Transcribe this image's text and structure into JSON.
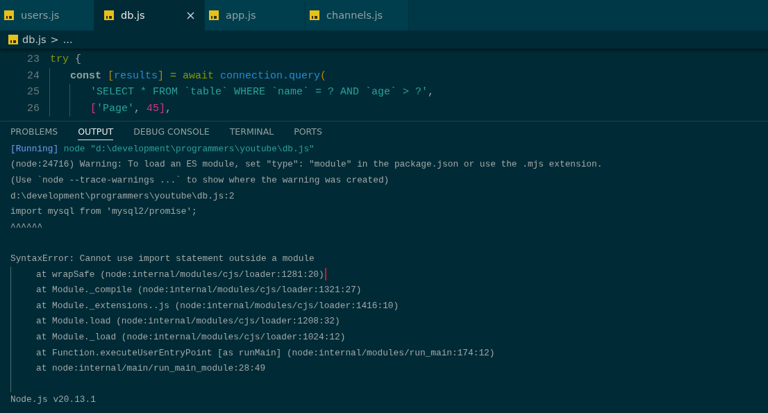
{
  "tabs": [
    {
      "label": "users.js",
      "selected": false
    },
    {
      "label": "db.js",
      "selected": true
    },
    {
      "label": "app.js",
      "selected": false
    },
    {
      "label": "channels.js",
      "selected": false
    }
  ],
  "breadcrumb": {
    "file": "db.js",
    "separator": ">",
    "rest": "..."
  },
  "editor": {
    "lines": [
      {
        "number": "23",
        "tokens": [
          {
            "kind": "keyword",
            "text": "try"
          },
          {
            "kind": "plain",
            "text": " {"
          }
        ],
        "children": [
          {
            "number": "24",
            "tokens": [
              {
                "kind": "storage",
                "text": "const "
              },
              {
                "kind": "bracket",
                "text": "["
              },
              {
                "kind": "variable",
                "text": "results"
              },
              {
                "kind": "bracket",
                "text": "] "
              },
              {
                "kind": "keyword",
                "text": "= await "
              },
              {
                "kind": "variable",
                "text": "connection.query"
              },
              {
                "kind": "bracket",
                "text": "("
              }
            ],
            "children": [
              {
                "number": "25",
                "tokens": [
                  {
                    "kind": "string",
                    "text": "'SELECT * FROM `table` WHERE `name` = ? AND `age` > ?'"
                  },
                  {
                    "kind": "plain",
                    "text": ","
                  }
                ]
              },
              {
                "number": "26",
                "tokens": [
                  {
                    "kind": "array",
                    "text": "["
                  },
                  {
                    "kind": "string",
                    "text": "'Page'"
                  },
                  {
                    "kind": "plain",
                    "text": ", "
                  },
                  {
                    "kind": "number",
                    "text": "45"
                  },
                  {
                    "kind": "array",
                    "text": "]"
                  },
                  {
                    "kind": "plain",
                    "text": ","
                  }
                ]
              }
            ]
          }
        ]
      }
    ]
  },
  "panel": {
    "tabs": [
      {
        "label": "PROBLEMS",
        "selected": false
      },
      {
        "label": "OUTPUT",
        "selected": true
      },
      {
        "label": "DEBUG CONSOLE",
        "selected": false
      },
      {
        "label": "TERMINAL",
        "selected": false
      },
      {
        "label": "PORTS",
        "selected": false
      }
    ],
    "output": [
      {
        "kind": "text",
        "segments": [
          {
            "kind": "tag",
            "text": "[Running]"
          },
          {
            "kind": "command",
            "text": " node \"d:\\development\\programmers\\youtube\\db.js\""
          }
        ]
      },
      {
        "kind": "text",
        "segments": [
          {
            "kind": "plain",
            "text": "(node:24716) Warning: To load an ES module, set \"type\": \"module\" in the package.json or use the .mjs extension."
          }
        ]
      },
      {
        "kind": "text",
        "segments": [
          {
            "kind": "plain",
            "text": "(Use `node --trace-warnings ...` to show where the warning was created)"
          }
        ]
      },
      {
        "kind": "text",
        "segments": [
          {
            "kind": "plain",
            "text": "d:\\development\\programmers\\youtube\\db.js:2"
          }
        ]
      },
      {
        "kind": "text",
        "segments": [
          {
            "kind": "plain",
            "text": "import mysql from 'mysql2/promise';"
          }
        ]
      },
      {
        "kind": "text",
        "segments": [
          {
            "kind": "plain",
            "text": "^^^^^^"
          }
        ]
      },
      {
        "kind": "blank"
      },
      {
        "kind": "text",
        "segments": [
          {
            "kind": "plain",
            "text": "SyntaxError: Cannot use import statement outside a module"
          }
        ]
      },
      {
        "kind": "stack",
        "cursor": true,
        "text": "at wrapSafe (node:internal/modules/cjs/loader:1281:20)"
      },
      {
        "kind": "stack",
        "cursor": false,
        "text": "at Module._compile (node:internal/modules/cjs/loader:1321:27)"
      },
      {
        "kind": "stack",
        "cursor": false,
        "text": "at Module._extensions..js (node:internal/modules/cjs/loader:1416:10)"
      },
      {
        "kind": "stack",
        "cursor": false,
        "text": "at Module.load (node:internal/modules/cjs/loader:1208:32)"
      },
      {
        "kind": "stack",
        "cursor": false,
        "text": "at Module._load (node:internal/modules/cjs/loader:1024:12)"
      },
      {
        "kind": "stack",
        "cursor": false,
        "text": "at Function.executeUserEntryPoint [as runMain] (node:internal/modules/run_main:174:12)"
      },
      {
        "kind": "stack",
        "cursor": false,
        "text": "at node:internal/main/run_main_module:28:49"
      },
      {
        "kind": "stackblank"
      },
      {
        "kind": "text",
        "segments": [
          {
            "kind": "plain",
            "text": "Node.js v20.13.1"
          }
        ]
      }
    ]
  }
}
